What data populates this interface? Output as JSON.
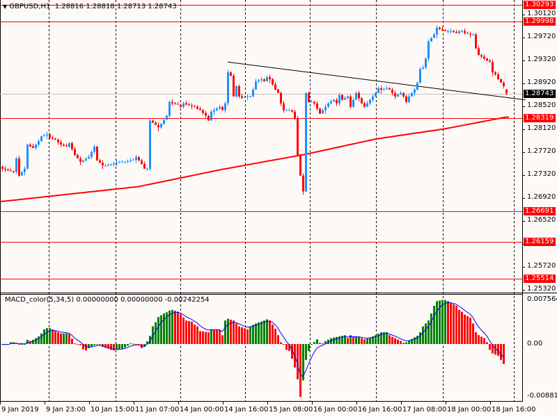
{
  "header": {
    "symbol": "GBPUSD,H1",
    "ohlc": "1.28816 1.28818 1.28713 1.28743",
    "icon": "triangle-down-icon"
  },
  "macd_header": "MACD_color(5,34,5) 0.00000000 0.00000000 -0.00242254",
  "colors": {
    "bull": "#1e90ff",
    "bear": "#ff0000",
    "ma": "#ff0000",
    "level": "#ff0000",
    "trend": "#000000",
    "hist_up": "#008000",
    "hist_down": "#ff0000",
    "signal": "#0000ff",
    "grid": "#000000",
    "background": "#fdf9f7"
  },
  "chart_data": [
    {
      "type": "candlestick",
      "title": "GBPUSD,H1",
      "ylim": [
        1.2522,
        1.3037
      ],
      "price_ticks": [
        "1.30120",
        "1.29720",
        "1.29320",
        "1.28920",
        "1.28520",
        "1.28120",
        "1.27720",
        "1.27320",
        "1.26920",
        "1.26520",
        "1.26120",
        "1.25720",
        "1.25320"
      ],
      "x_tick_labels": [
        "9 Jan 2019",
        "9 Jan 23:00",
        "10 Jan 15:00",
        "11 Jan 07:00",
        "14 Jan 00:00",
        "14 Jan 16:00",
        "15 Jan 08:00",
        "16 Jan 00:00",
        "16 Jan 16:00",
        "17 Jan 08:00",
        "18 Jan 00:00",
        "18 Jan 16:00"
      ],
      "last_bar": {
        "open": 1.28816,
        "high": 1.28818,
        "low": 1.28713,
        "close": 1.28743
      },
      "close_keypoints_bar_close": [
        [
          1,
          1.27432
        ],
        [
          5,
          1.27372
        ],
        [
          6,
          1.27612
        ],
        [
          7,
          1.27312
        ],
        [
          9,
          1.27432
        ],
        [
          10,
          1.27852
        ],
        [
          12,
          1.27792
        ],
        [
          14,
          1.27912
        ],
        [
          15,
          1.27996
        ],
        [
          17,
          1.28032
        ],
        [
          18,
          1.27972
        ],
        [
          20,
          1.27936
        ],
        [
          22,
          1.27852
        ],
        [
          24,
          1.27816
        ],
        [
          25,
          1.27876
        ],
        [
          27,
          1.27672
        ],
        [
          29,
          1.27552
        ],
        [
          30,
          1.27576
        ],
        [
          32,
          1.27636
        ],
        [
          34,
          1.27816
        ],
        [
          35,
          1.27576
        ],
        [
          37,
          1.27492
        ],
        [
          39,
          1.27492
        ],
        [
          42,
          1.2754
        ],
        [
          45,
          1.27552
        ],
        [
          48,
          1.27588
        ],
        [
          49,
          1.27636
        ],
        [
          51,
          1.27516
        ],
        [
          52,
          1.27432
        ],
        [
          53,
          1.27432
        ],
        [
          54,
          1.28272
        ],
        [
          55,
          1.28236
        ],
        [
          57,
          1.28152
        ],
        [
          58,
          1.28212
        ],
        [
          60,
          1.28356
        ],
        [
          61,
          1.28596
        ],
        [
          62,
          1.28572
        ],
        [
          64,
          1.28548
        ],
        [
          65,
          1.28512
        ],
        [
          66,
          1.28572
        ],
        [
          68,
          1.28536
        ],
        [
          70,
          1.28512
        ],
        [
          71,
          1.28476
        ],
        [
          72,
          1.28452
        ],
        [
          74,
          1.28356
        ],
        [
          75,
          1.28272
        ],
        [
          76,
          1.28428
        ],
        [
          77,
          1.28452
        ],
        [
          79,
          1.28512
        ],
        [
          80,
          1.28452
        ],
        [
          81,
          1.28572
        ],
        [
          82,
          1.29112
        ],
        [
          83,
          1.29052
        ],
        [
          84,
          1.28692
        ],
        [
          85,
          1.28872
        ],
        [
          86,
          1.28692
        ],
        [
          87,
          1.28668
        ],
        [
          89,
          1.28692
        ],
        [
          90,
          1.28692
        ],
        [
          91,
          1.28812
        ],
        [
          92,
          1.28956
        ],
        [
          94,
          1.28992
        ],
        [
          95,
          1.28956
        ],
        [
          96,
          1.29028
        ],
        [
          97,
          1.28992
        ],
        [
          99,
          1.28812
        ],
        [
          100,
          1.28752
        ],
        [
          101,
          1.28572
        ],
        [
          102,
          1.28452
        ],
        [
          104,
          1.28452
        ],
        [
          105,
          1.28428
        ],
        [
          106,
          1.28308
        ],
        [
          107,
          1.27672
        ],
        [
          108,
          1.27312
        ],
        [
          109,
          1.27036
        ],
        [
          110,
          1.28752
        ],
        [
          111,
          1.28596
        ],
        [
          112,
          1.28596
        ],
        [
          113,
          1.28572
        ],
        [
          115,
          1.28392
        ],
        [
          116,
          1.28452
        ],
        [
          117,
          1.28512
        ],
        [
          118,
          1.28572
        ],
        [
          120,
          1.28632
        ],
        [
          121,
          1.28572
        ],
        [
          122,
          1.28716
        ],
        [
          123,
          1.28632
        ],
        [
          125,
          1.28692
        ],
        [
          126,
          1.28512
        ],
        [
          127,
          1.28632
        ],
        [
          128,
          1.28752
        ],
        [
          130,
          1.28572
        ],
        [
          131,
          1.28512
        ],
        [
          132,
          1.28572
        ],
        [
          133,
          1.28632
        ],
        [
          135,
          1.28752
        ],
        [
          136,
          1.28836
        ],
        [
          137,
          1.28812
        ],
        [
          139,
          1.28836
        ],
        [
          140,
          1.28812
        ],
        [
          141,
          1.28752
        ],
        [
          142,
          1.28692
        ],
        [
          144,
          1.28752
        ],
        [
          145,
          1.28692
        ],
        [
          146,
          1.28596
        ],
        [
          147,
          1.28692
        ],
        [
          149,
          1.28812
        ],
        [
          150,
          1.28932
        ],
        [
          151,
          1.29172
        ],
        [
          152,
          1.29196
        ],
        [
          153,
          1.29352
        ],
        [
          154,
          1.29652
        ],
        [
          155,
          1.29712
        ],
        [
          156,
          1.29772
        ],
        [
          157,
          1.29892
        ],
        [
          158,
          1.29868
        ],
        [
          160,
          1.29832
        ],
        [
          162,
          1.29832
        ],
        [
          164,
          1.29796
        ],
        [
          165,
          1.29832
        ],
        [
          166,
          1.29832
        ],
        [
          167,
          1.29796
        ],
        [
          169,
          1.29772
        ],
        [
          170,
          1.29772
        ],
        [
          171,
          1.29532
        ],
        [
          172,
          1.29412
        ],
        [
          173,
          1.29388
        ],
        [
          174,
          1.29352
        ],
        [
          175,
          1.29316
        ],
        [
          176,
          1.29292
        ],
        [
          177,
          1.29112
        ],
        [
          178,
          1.29076
        ],
        [
          179,
          1.28992
        ],
        [
          180,
          1.28932
        ],
        [
          181,
          1.28872
        ],
        [
          182,
          1.28743
        ]
      ],
      "moving_average_keypoints": [
        [
          0,
          1.26856
        ],
        [
          50,
          1.2712
        ],
        [
          80,
          1.2742
        ],
        [
          110,
          1.27684
        ],
        [
          135,
          1.27948
        ],
        [
          160,
          1.28128
        ],
        [
          182,
          1.28332
        ]
      ],
      "trendline": [
        [
          82,
          1.29292
        ],
        [
          189,
          1.28632
        ]
      ],
      "levels": [
        {
          "price": 1.30293,
          "label": "1.30293"
        },
        {
          "price": 1.29998,
          "label": "1.29998"
        },
        {
          "price": 1.28319,
          "label": "1.28319"
        },
        {
          "price": 1.26691,
          "label": "1.26691"
        },
        {
          "price": 1.26159,
          "label": "1.26159"
        },
        {
          "price": 1.25514,
          "label": "1.25514"
        }
      ],
      "current_price": {
        "price": 1.28743,
        "label": "1.28743"
      }
    },
    {
      "type": "bar",
      "title": "MACD_color(5,34,5)",
      "ylim": [
        -0.00881,
        0.0075642
      ],
      "y_tick_labels": [
        "0.0075642",
        "0.00",
        "-0.008810"
      ],
      "histogram_keypoints_bar_value": [
        [
          1,
          -0.0001
        ],
        [
          3,
          -0.0001
        ],
        [
          4,
          0.0003
        ],
        [
          5,
          0.0003
        ],
        [
          7,
          0
        ],
        [
          9,
          0
        ],
        [
          10,
          0.0007
        ],
        [
          11,
          0.0005
        ],
        [
          12,
          0.0007
        ],
        [
          14,
          0.0013
        ],
        [
          15,
          0.0018
        ],
        [
          16,
          0.0025
        ],
        [
          17,
          0.0027
        ],
        [
          18,
          0.0027
        ],
        [
          19,
          0.0025
        ],
        [
          20,
          0.0022
        ],
        [
          21,
          0.002
        ],
        [
          22,
          0.0018
        ],
        [
          24,
          0.0018
        ],
        [
          25,
          0.0017
        ],
        [
          26,
          0.0009
        ],
        [
          27,
          0.0001
        ],
        [
          29,
          -0.0002
        ],
        [
          30,
          -0.0009
        ],
        [
          31,
          -0.0011
        ],
        [
          32,
          -0.0007
        ],
        [
          34,
          -0.0002
        ],
        [
          35,
          -0.0001
        ],
        [
          36,
          -0.0001
        ],
        [
          37,
          -0.0005
        ],
        [
          39,
          -0.0008
        ],
        [
          40,
          -0.001
        ],
        [
          41,
          -0.0011
        ],
        [
          42,
          -0.001
        ],
        [
          44,
          -0.0008
        ],
        [
          45,
          -0.0006
        ],
        [
          46,
          -0.0003
        ],
        [
          47,
          0.0001
        ],
        [
          49,
          0
        ],
        [
          50,
          -0.0001
        ],
        [
          51,
          -0.0007
        ],
        [
          52,
          -0.0005
        ],
        [
          54,
          0.0014
        ],
        [
          55,
          0.003
        ],
        [
          56,
          0.0037
        ],
        [
          57,
          0.0046
        ],
        [
          59,
          0.0052
        ],
        [
          60,
          0.0054
        ],
        [
          61,
          0.0057
        ],
        [
          62,
          0.0058
        ],
        [
          64,
          0.0055
        ],
        [
          65,
          0.005
        ],
        [
          66,
          0.0045
        ],
        [
          67,
          0.004
        ],
        [
          69,
          0.0038
        ],
        [
          70,
          0.0033
        ],
        [
          71,
          0.003
        ],
        [
          72,
          0.0022
        ],
        [
          75,
          0.002
        ],
        [
          76,
          0.0025
        ],
        [
          79,
          0.0024
        ],
        [
          80,
          0.0015
        ],
        [
          81,
          0.004
        ],
        [
          82,
          0.0043
        ],
        [
          84,
          0.004
        ],
        [
          86,
          0.003
        ],
        [
          89,
          0.0025
        ],
        [
          90,
          0.003
        ],
        [
          92,
          0.0035
        ],
        [
          95,
          0.004
        ],
        [
          96,
          0.0042
        ],
        [
          97,
          0.004
        ],
        [
          99,
          0.0026
        ],
        [
          100,
          0.0015
        ],
        [
          101,
          0.0003
        ],
        [
          102,
          -0.0001
        ],
        [
          103,
          -0.001
        ],
        [
          104,
          -0.0012
        ],
        [
          105,
          -0.0025
        ],
        [
          106,
          -0.004
        ],
        [
          107,
          -0.006
        ],
        [
          108,
          -0.009
        ],
        [
          109,
          -0.0062
        ],
        [
          110,
          -0.0027
        ],
        [
          111,
          -0.0012
        ],
        [
          112,
          -0.0001
        ],
        [
          114,
          0.0008
        ],
        [
          115,
          0.0002
        ],
        [
          116,
          0.0001
        ],
        [
          117,
          0.0005
        ],
        [
          119,
          0.001
        ],
        [
          121,
          0.0012
        ],
        [
          124,
          0.0015
        ],
        [
          125,
          0.001
        ],
        [
          126,
          0.0015
        ],
        [
          127,
          0.0012
        ],
        [
          129,
          0.0012
        ],
        [
          130,
          0.001
        ],
        [
          131,
          0.0008
        ],
        [
          132,
          0.0009
        ],
        [
          135,
          0.0015
        ],
        [
          137,
          0.002
        ],
        [
          139,
          0.002
        ],
        [
          140,
          0.0015
        ],
        [
          141,
          0.0012
        ],
        [
          142,
          0.001
        ],
        [
          144,
          0.0005
        ],
        [
          145,
          0.0002
        ],
        [
          146,
          0.0003
        ],
        [
          147,
          0.0006
        ],
        [
          150,
          0.0014
        ],
        [
          151,
          0.002
        ],
        [
          152,
          0.003
        ],
        [
          154,
          0.004
        ],
        [
          155,
          0.0052
        ],
        [
          156,
          0.0065
        ],
        [
          157,
          0.0073
        ],
        [
          159,
          0.0075
        ],
        [
          160,
          0.0075
        ],
        [
          161,
          0.0073
        ],
        [
          162,
          0.007
        ],
        [
          164,
          0.0065
        ],
        [
          165,
          0.0058
        ],
        [
          166,
          0.0055
        ],
        [
          167,
          0.005
        ],
        [
          169,
          0.0045
        ],
        [
          170,
          0.0035
        ],
        [
          171,
          0.002
        ],
        [
          172,
          0.0015
        ],
        [
          174,
          0.001
        ],
        [
          175,
          0.0003
        ],
        [
          176,
          -0.001
        ],
        [
          177,
          -0.0016
        ],
        [
          179,
          -0.002
        ],
        [
          180,
          -0.0027
        ],
        [
          181,
          -0.0034
        ]
      ]
    }
  ]
}
